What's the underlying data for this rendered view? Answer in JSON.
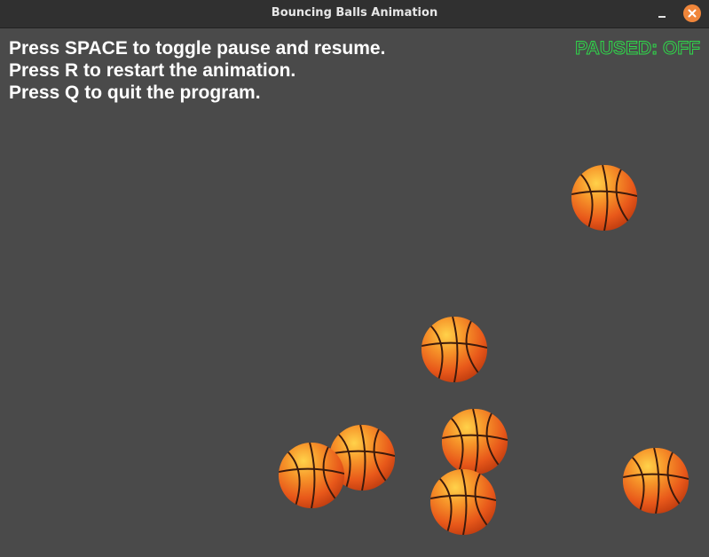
{
  "window": {
    "title": "Bouncing Balls Animation"
  },
  "instructions": [
    "Press SPACE to toggle pause and resume.",
    "Press R to restart the animation.",
    "Press Q to quit the program."
  ],
  "status": {
    "paused_text": "PAUSED: OFF",
    "color": "#2fd94a"
  },
  "colors": {
    "background": "#4a4a4a",
    "titlebar": "#303030",
    "close_button": "#f0863a",
    "ball": "#f07a1a"
  },
  "balls": {
    "count": 7,
    "icon": "basketball-icon"
  }
}
